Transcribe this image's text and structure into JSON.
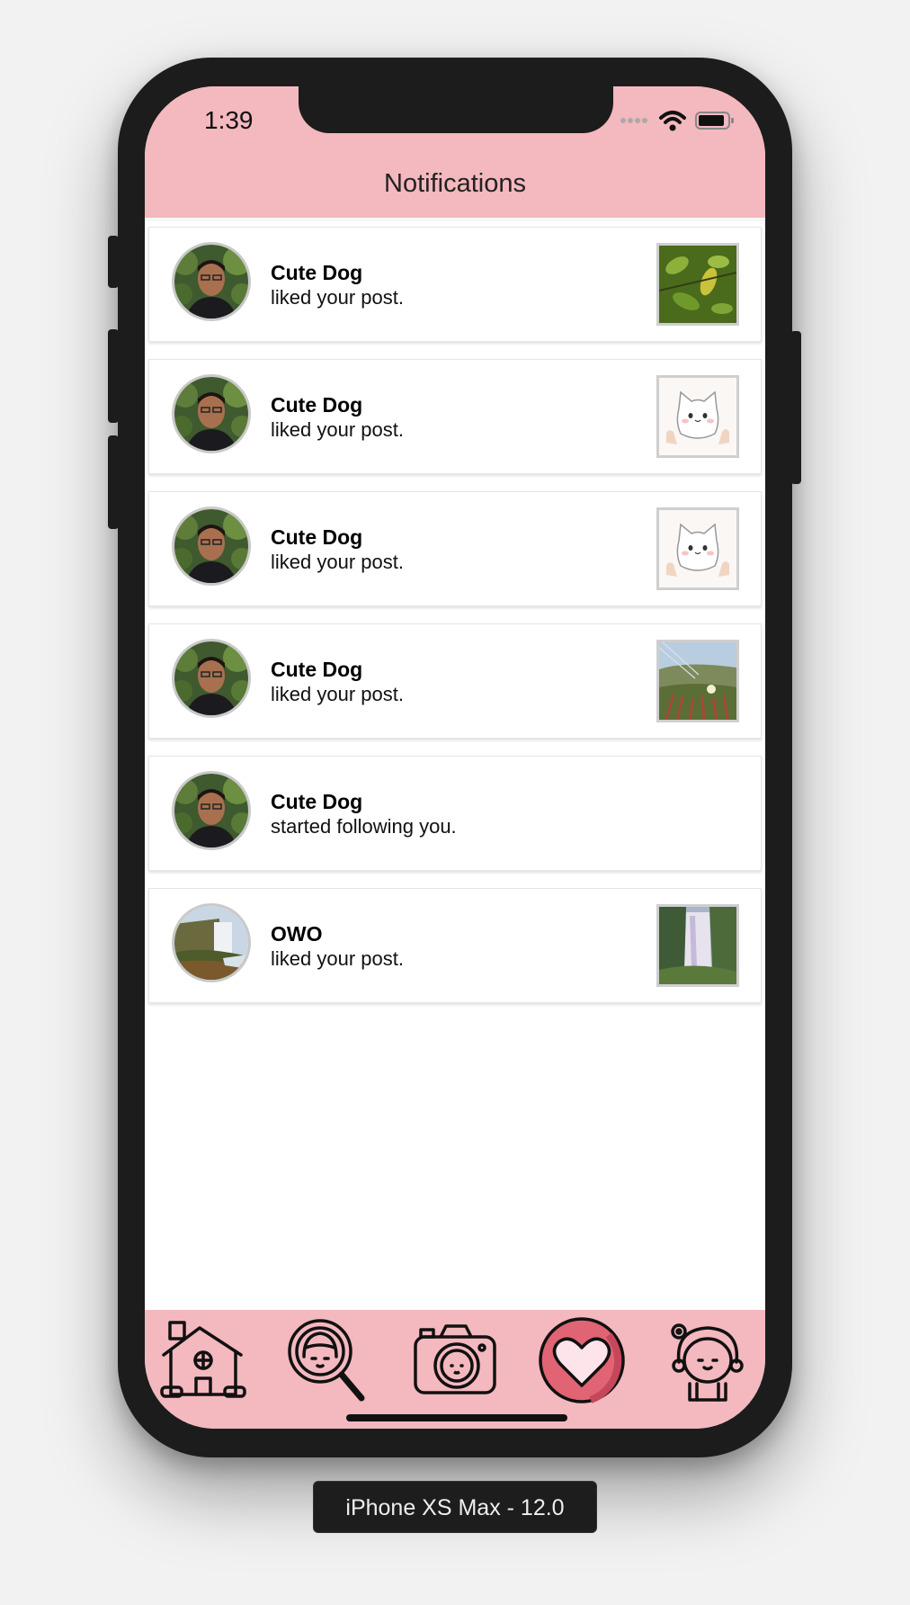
{
  "status_bar": {
    "time": "1:39"
  },
  "header": {
    "title": "Notifications"
  },
  "notifications": [
    {
      "user": "Cute Dog",
      "action": "liked your post.",
      "thumb": "leaves"
    },
    {
      "user": "Cute Dog",
      "action": "liked your post.",
      "thumb": "cat"
    },
    {
      "user": "Cute Dog",
      "action": "liked your post.",
      "thumb": "cat"
    },
    {
      "user": "Cute Dog",
      "action": "liked your post.",
      "thumb": "plant"
    },
    {
      "user": "Cute Dog",
      "action": "started following you.",
      "thumb": ""
    },
    {
      "user": "OWO",
      "action": "liked your post.",
      "thumb": "waterfall"
    }
  ],
  "tabs": [
    {
      "name": "home-icon"
    },
    {
      "name": "search-icon"
    },
    {
      "name": "camera-icon"
    },
    {
      "name": "heart-icon",
      "active": true
    },
    {
      "name": "profile-icon"
    }
  ],
  "device_label": "iPhone XS Max - 12.0",
  "colors": {
    "accent": "#f4b8bf",
    "heart": "#e06473"
  }
}
